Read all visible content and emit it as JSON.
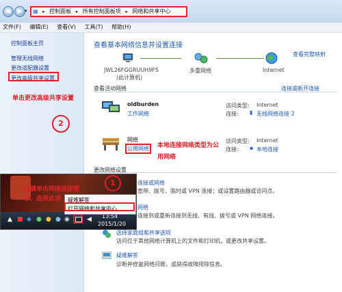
{
  "addressbar": {
    "crumbs": [
      "控制面板",
      "所有控制面板项",
      "网络和共享中心"
    ]
  },
  "menubar": [
    "文件(F)",
    "编辑(E)",
    "查看(V)",
    "工具(T)",
    "帮助(H)"
  ],
  "sidebar": {
    "items": [
      "控制面板主页",
      "管理无线网络",
      "更改适配器设置",
      "更改高级共享设置"
    ],
    "annotation": "单击更改高级共享设置",
    "step": "2"
  },
  "main": {
    "title": "查看基本网络信息并设置连接",
    "full_map": "查看完整映射",
    "map": {
      "computer": "JWL26FGGRUUH9FS",
      "computer_sub": "(此计算机)",
      "multi": "多重网络",
      "internet": "Internet"
    },
    "active_title": "查看活动网络",
    "connect_link": "连接或断开连接",
    "net1": {
      "name": "oldburden",
      "type": "工作网络",
      "access_label": "访问类型:",
      "access_value": "Internet",
      "conn_label": "连接:",
      "conn_value": "无线网络连接 2"
    },
    "net2": {
      "name": "网络",
      "type": "公用网络",
      "access_label": "访问类型:",
      "access_value": "Internet",
      "conn_label": "连接:",
      "conn_value": "本地连接"
    },
    "annotation2a": "本地连接网络类型为公",
    "annotation2b": "用网络",
    "change_title": "更改网络设置",
    "tasks": [
      {
        "link": "连接或网络",
        "desc": "宽带、拨号、临时或 VPN 连接；或设置路由器或访问点。"
      },
      {
        "link": "网络",
        "desc": "连接到或重新连接到无线、有线、拨号或 VPN 网络连接。"
      },
      {
        "link": "选择家庭组和共享选项",
        "desc": "访问位于其他网络计算机上的文件和打印机，或更改共享设置。"
      },
      {
        "link": "疑难解答",
        "desc": "诊断并修复网络问题，或获得故障排除信息。"
      }
    ]
  },
  "taskbar": {
    "annotation1a": "右键单击网络连接图",
    "annotation1b": "标，选择此项",
    "step": "1",
    "menu_item1": "疑难解答",
    "menu_item2": "打开网络和共享中心",
    "time": "13:54",
    "date": "2015/1/20"
  }
}
